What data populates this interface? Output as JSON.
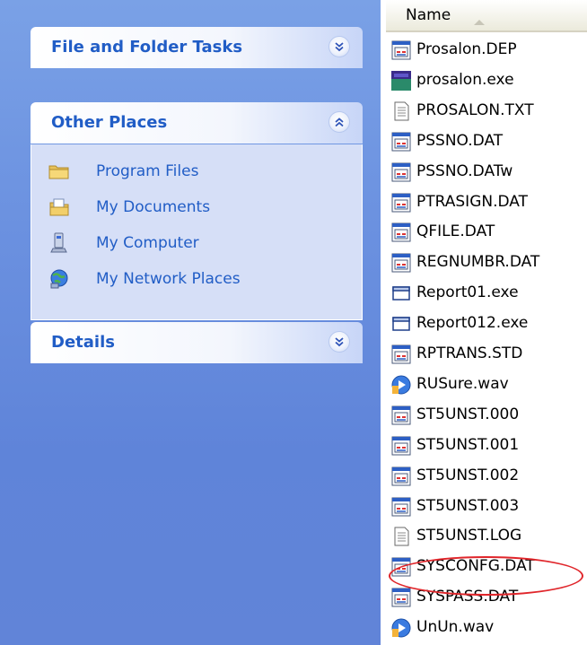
{
  "task_pane": {
    "file_folder_tasks": {
      "title": "File and Folder Tasks",
      "expander_icon": "chevron-double-down-icon"
    },
    "other_places": {
      "title": "Other Places",
      "expander_icon": "chevron-double-up-icon",
      "items": [
        {
          "label": "Program Files",
          "icon": "folder-icon"
        },
        {
          "label": "My Documents",
          "icon": "my-documents-icon"
        },
        {
          "label": "My Computer",
          "icon": "my-computer-icon"
        },
        {
          "label": "My Network Places",
          "icon": "network-places-icon"
        }
      ]
    },
    "details": {
      "title": "Details",
      "expander_icon": "chevron-double-down-icon"
    }
  },
  "file_list": {
    "column_header": "Name",
    "sort": "ascending",
    "files": [
      {
        "name": "Prosalon.DEP",
        "icon": "dat-file-icon"
      },
      {
        "name": "prosalon.exe",
        "icon": "application-icon"
      },
      {
        "name": "PROSALON.TXT",
        "icon": "text-file-icon"
      },
      {
        "name": "PSSNO.DAT",
        "icon": "dat-file-icon"
      },
      {
        "name": "PSSNO.DATw",
        "icon": "dat-file-icon"
      },
      {
        "name": "PTRASIGN.DAT",
        "icon": "dat-file-icon"
      },
      {
        "name": "QFILE.DAT",
        "icon": "dat-file-icon"
      },
      {
        "name": "REGNUMBR.DAT",
        "icon": "dat-file-icon"
      },
      {
        "name": "Report01.exe",
        "icon": "exe-window-icon"
      },
      {
        "name": "Report012.exe",
        "icon": "exe-window-icon"
      },
      {
        "name": "RPTRANS.STD",
        "icon": "dat-file-icon"
      },
      {
        "name": "RUSure.wav",
        "icon": "audio-file-icon"
      },
      {
        "name": "ST5UNST.000",
        "icon": "dat-file-icon"
      },
      {
        "name": "ST5UNST.001",
        "icon": "dat-file-icon"
      },
      {
        "name": "ST5UNST.002",
        "icon": "dat-file-icon"
      },
      {
        "name": "ST5UNST.003",
        "icon": "dat-file-icon"
      },
      {
        "name": "ST5UNST.LOG",
        "icon": "text-file-icon"
      },
      {
        "name": "SYSCONFG.DAT",
        "icon": "dat-file-icon",
        "highlighted": true
      },
      {
        "name": "SYSPASS.DAT",
        "icon": "dat-file-icon"
      },
      {
        "name": "UnUn.wav",
        "icon": "audio-file-icon"
      }
    ]
  },
  "colors": {
    "pane_gradient": "#6b91e0",
    "link_blue": "#215dc6",
    "highlight_ring": "#e0262b"
  }
}
